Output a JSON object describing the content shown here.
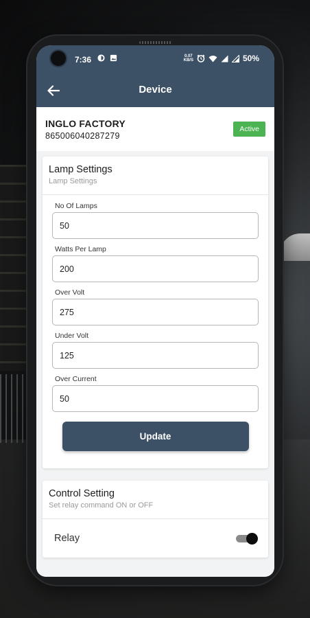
{
  "status_bar": {
    "time": "7:36",
    "data_speed": "0.07",
    "data_unit": "KB/S",
    "battery": "50%"
  },
  "app_bar": {
    "title": "Device",
    "back_icon": "arrow-left-icon"
  },
  "device": {
    "name": "INGLO FACTORY",
    "id": "865006040287279",
    "status": "Active",
    "status_color": "#4bb352"
  },
  "lamp_settings": {
    "title": "Lamp Settings",
    "subtitle": "Lamp Settings",
    "fields": [
      {
        "label": "No Of Lamps",
        "value": "50"
      },
      {
        "label": "Watts Per Lamp",
        "value": "200"
      },
      {
        "label": "Over Volt",
        "value": "275"
      },
      {
        "label": "Under Volt",
        "value": "125"
      },
      {
        "label": "Over Current",
        "value": "50"
      }
    ],
    "update_label": "Update"
  },
  "control_setting": {
    "title": "Control Setting",
    "subtitle": "Set relay command ON or OFF",
    "relay_label": "Relay",
    "relay_on": true
  },
  "colors": {
    "primary": "#3c5066",
    "accent_green": "#4bb352"
  }
}
